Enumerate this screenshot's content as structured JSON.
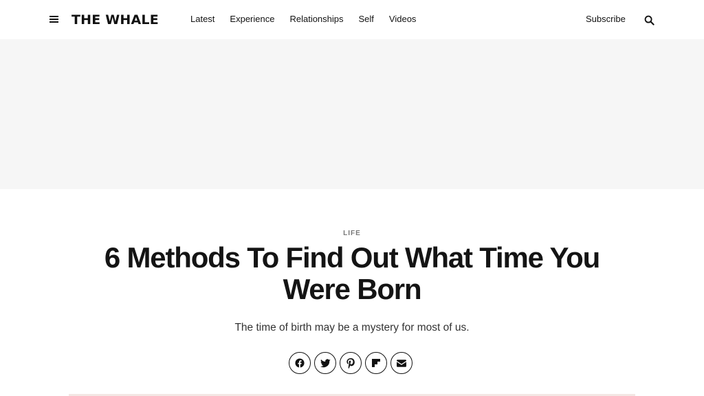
{
  "header": {
    "logo": "THE WHALE",
    "nav": [
      "Latest",
      "Experience",
      "Relationships",
      "Self",
      "Videos"
    ],
    "subscribe_label": "Subscribe",
    "icons": {
      "menu": "hamburger-menu-icon",
      "search": "search-icon"
    }
  },
  "article": {
    "category": "LIFE",
    "title": "6 Methods To Find Out What Time You Were Born",
    "subtitle": "The time of birth may be a mystery for most of us."
  },
  "share": {
    "icons": [
      "facebook-icon",
      "twitter-icon",
      "pinterest-icon",
      "flipboard-icon",
      "email-icon"
    ]
  },
  "colors": {
    "ad_background": "#f6f6f6",
    "text": "#111111",
    "kicker": "#777777"
  }
}
